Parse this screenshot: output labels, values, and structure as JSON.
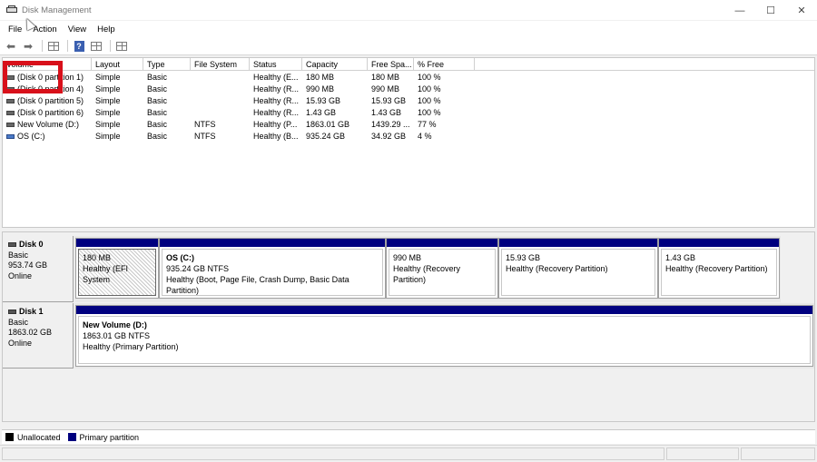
{
  "window": {
    "title": "Disk Management",
    "controls": {
      "minimize": "—",
      "maximize": "☐",
      "close": "✕"
    }
  },
  "menu": [
    "File",
    "Action",
    "View",
    "Help"
  ],
  "toolbar": {
    "icons": [
      "back-arrow-icon",
      "forward-arrow-icon",
      "list-view-icon",
      "help-icon",
      "properties-icon",
      "console-icon"
    ],
    "back_glyph": "⬅",
    "forward_glyph": "➡",
    "help_glyph": "?"
  },
  "volume_list": {
    "columns": [
      "Volume",
      "Layout",
      "Type",
      "File System",
      "Status",
      "Capacity",
      "Free Spa...",
      "% Free"
    ],
    "rows": [
      {
        "volume": "(Disk 0 partition 1)",
        "layout": "Simple",
        "type": "Basic",
        "fs": "",
        "status": "Healthy (E...",
        "capacity": "180 MB",
        "free": "180 MB",
        "pct": "100 %"
      },
      {
        "volume": "(Disk 0 partition 4)",
        "layout": "Simple",
        "type": "Basic",
        "fs": "",
        "status": "Healthy (R...",
        "capacity": "990 MB",
        "free": "990 MB",
        "pct": "100 %"
      },
      {
        "volume": "(Disk 0 partition 5)",
        "layout": "Simple",
        "type": "Basic",
        "fs": "",
        "status": "Healthy (R...",
        "capacity": "15.93 GB",
        "free": "15.93 GB",
        "pct": "100 %"
      },
      {
        "volume": "(Disk 0 partition 6)",
        "layout": "Simple",
        "type": "Basic",
        "fs": "",
        "status": "Healthy (R...",
        "capacity": "1.43 GB",
        "free": "1.43 GB",
        "pct": "100 %"
      },
      {
        "volume": "New Volume (D:)",
        "layout": "Simple",
        "type": "Basic",
        "fs": "NTFS",
        "status": "Healthy (P...",
        "capacity": "1863.01 GB",
        "free": "1439.29 ...",
        "pct": "77 %"
      },
      {
        "volume": "OS (C:)",
        "layout": "Simple",
        "type": "Basic",
        "fs": "NTFS",
        "status": "Healthy (B...",
        "capacity": "935.24 GB",
        "free": "34.92 GB",
        "pct": "4 %"
      }
    ]
  },
  "disks": [
    {
      "name": "Disk 0",
      "kind": "Basic",
      "size": "953.74 GB",
      "state": "Online",
      "partitions": [
        {
          "name": "",
          "size": "180 MB",
          "status": "Healthy (EFI System"
        },
        {
          "name": "OS  (C:)",
          "size": "935.24 GB NTFS",
          "status": "Healthy (Boot, Page File, Crash Dump, Basic Data Partition)"
        },
        {
          "name": "",
          "size": "990 MB",
          "status": "Healthy (Recovery Partition)"
        },
        {
          "name": "",
          "size": "15.93 GB",
          "status": "Healthy (Recovery Partition)"
        },
        {
          "name": "",
          "size": "1.43 GB",
          "status": "Healthy (Recovery Partition)"
        }
      ]
    },
    {
      "name": "Disk 1",
      "kind": "Basic",
      "size": "1863.02 GB",
      "state": "Online",
      "partitions": [
        {
          "name": "New Volume  (D:)",
          "size": "1863.01 GB NTFS",
          "status": "Healthy (Primary Partition)"
        }
      ]
    }
  ],
  "legend": [
    {
      "label": "Unallocated",
      "color": "#000000"
    },
    {
      "label": "Primary partition",
      "color": "#00007f"
    }
  ],
  "colors": {
    "primary_partition": "#00007f",
    "highlight": "#d8101a"
  }
}
